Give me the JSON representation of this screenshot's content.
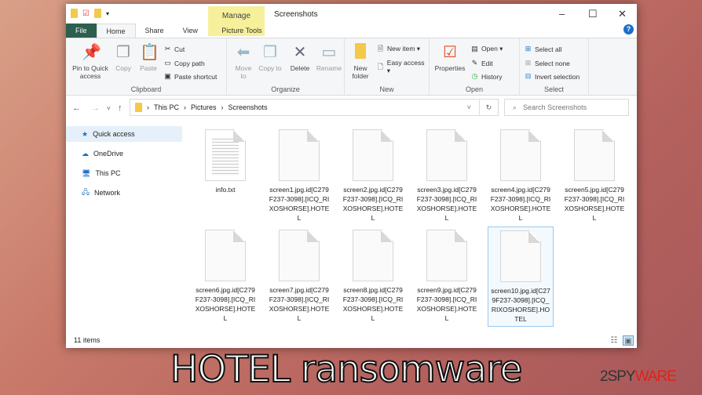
{
  "window": {
    "title": "Screenshots",
    "manage": "Manage",
    "minimize": "–",
    "maximize": "☐",
    "close": "✕"
  },
  "tabs": [
    "File",
    "Home",
    "Share",
    "View",
    "Picture Tools"
  ],
  "ribbon": {
    "clipboard": {
      "label": "Clipboard",
      "pin": "Pin to Quick access",
      "copy": "Copy",
      "paste": "Paste",
      "cut": "Cut",
      "copy_path": "Copy path",
      "paste_shortcut": "Paste shortcut"
    },
    "organize": {
      "label": "Organize",
      "move_to": "Move to",
      "copy_to": "Copy to",
      "delete": "Delete",
      "rename": "Rename"
    },
    "new": {
      "label": "New",
      "new_folder": "New folder",
      "new_item": "New item ▾",
      "easy_access": "Easy access ▾"
    },
    "open": {
      "label": "Open",
      "properties": "Properties",
      "open": "Open ▾",
      "edit": "Edit",
      "history": "History"
    },
    "select": {
      "label": "Select",
      "select_all": "Select all",
      "select_none": "Select none",
      "invert": "Invert selection"
    }
  },
  "address": {
    "path": [
      "This PC",
      "Pictures",
      "Screenshots"
    ],
    "search_placeholder": "Search Screenshots"
  },
  "sidebar": [
    {
      "label": "Quick access",
      "icon": "star-icon"
    },
    {
      "label": "OneDrive",
      "icon": "cloud-icon"
    },
    {
      "label": "This PC",
      "icon": "computer-icon"
    },
    {
      "label": "Network",
      "icon": "network-icon"
    }
  ],
  "files": [
    "info.txt",
    "screen1.jpg.id[C279F237-3098].[ICQ_RIXOSHORSE].HOTEL",
    "screen2.jpg.id[C279F237-3098].[ICQ_RIXOSHORSE].HOTEL",
    "screen3.jpg.id[C279F237-3098].[ICQ_RIXOSHORSE].HOTEL",
    "screen4.jpg.id[C279F237-3098].[ICQ_RIXOSHORSE].HOTEL",
    "screen5.jpg.id[C279F237-3098].[ICQ_RIXOSHORSE].HOTEL",
    "screen6.jpg.id[C279F237-3098].[ICQ_RIXOSHORSE].HOTEL",
    "screen7.jpg.id[C279F237-3098].[ICQ_RIXOSHORSE].HOTEL",
    "screen8.jpg.id[C279F237-3098].[ICQ_RIXOSHORSE].HOTEL",
    "screen9.jpg.id[C279F237-3098].[ICQ_RIXOSHORSE].HOTEL",
    "screen10.jpg.id[C279F237-3098].[ICQ_RIXOSHORSE].HOTEL"
  ],
  "status": "11 items",
  "caption": "HOTEL ransomware",
  "logo": "2SPYWARE",
  "colors": {
    "file_tab": "#2d5f4e",
    "manage": "#f6f09a",
    "accent": "#1a6fc9",
    "logo_red": "#e0221c"
  }
}
